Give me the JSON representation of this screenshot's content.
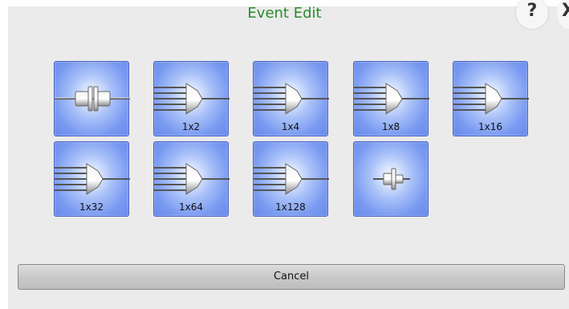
{
  "dialog": {
    "title": "Event Edit",
    "help_label": "?",
    "close_label": "X",
    "cancel_label": "Cancel"
  },
  "events": [
    {
      "icon": "connector-icon",
      "label": ""
    },
    {
      "icon": "splitter-icon",
      "label": "1x2"
    },
    {
      "icon": "splitter-icon",
      "label": "1x4"
    },
    {
      "icon": "splitter-icon",
      "label": "1x8"
    },
    {
      "icon": "splitter-icon",
      "label": "1x16"
    },
    {
      "icon": "splitter-icon",
      "label": "1x32"
    },
    {
      "icon": "splitter-icon",
      "label": "1x64"
    },
    {
      "icon": "splitter-icon",
      "label": "1x128"
    },
    {
      "icon": "end-connector-icon",
      "label": ""
    }
  ]
}
